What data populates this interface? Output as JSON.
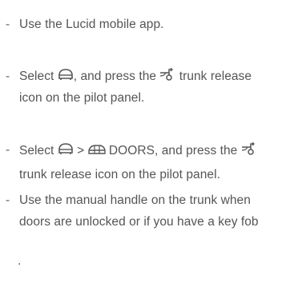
{
  "colors": {
    "text": "#555555",
    "dash": "#666666",
    "icon": "#555555"
  },
  "bullet": "-",
  "items": [
    {
      "segments": [
        "Use the Lucid mobile app."
      ]
    },
    {
      "segments": [
        "Select ",
        ", and press the ",
        " trunk release icon on the pilot panel."
      ],
      "icons": [
        "car-icon",
        "trunk-release-icon"
      ]
    },
    {
      "segments": [
        "Select ",
        " > ",
        " DOORS, and press the ",
        " trunk release icon on the pilot panel."
      ],
      "icons": [
        "car-icon",
        "car-doors-icon",
        "trunk-release-icon"
      ]
    },
    {
      "segments": [
        "Use the manual handle on the trunk when doors are unlocked or if you have a key fob"
      ]
    }
  ],
  "trailing_mark": "."
}
